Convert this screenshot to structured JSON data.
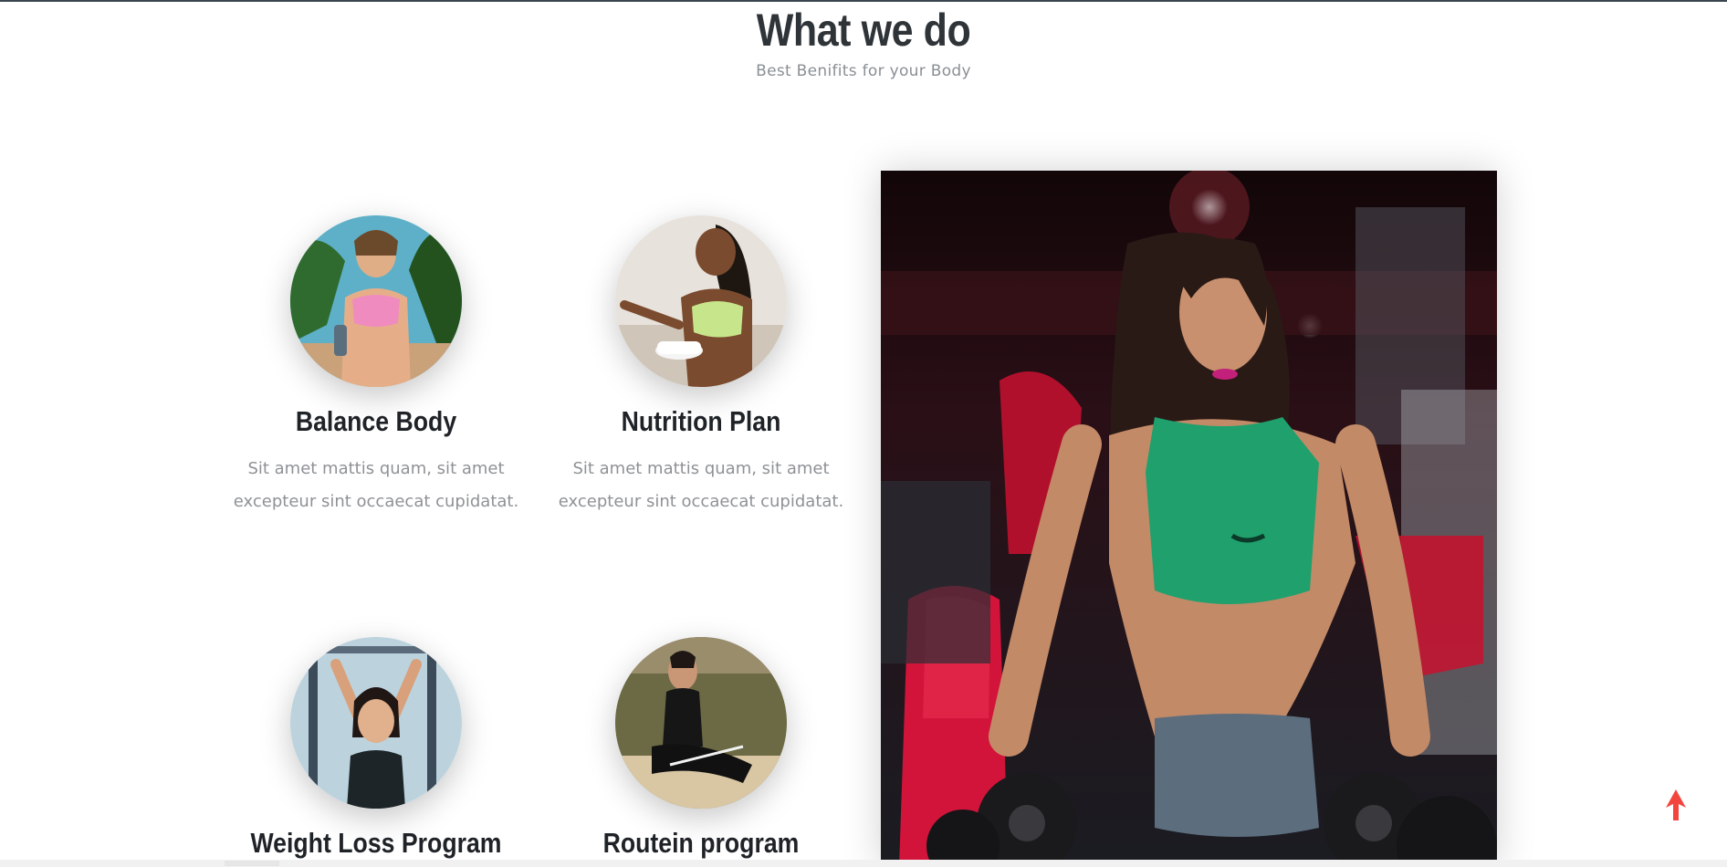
{
  "section": {
    "title": "What we do",
    "subtitle": "Best Benifits for your Body"
  },
  "services": [
    {
      "title": "Balance Body",
      "text": "Sit amet mattis quam, sit amet excepteur sint occaecat cupidatat."
    },
    {
      "title": "Nutrition Plan",
      "text": "Sit amet mattis quam, sit amet excepteur sint occaecat cupidatat."
    },
    {
      "title": "Weight Loss Program",
      "text": ""
    },
    {
      "title": "Routein program",
      "text": ""
    }
  ],
  "feature_image": {
    "alt": "fitness model photo",
    "colors": {
      "top": "#f06b4b",
      "accent": "#e21c3c",
      "top_wear": "#1f9a6a"
    }
  },
  "scroll_top": {
    "icon": "arrow-up-icon",
    "color": "#f2453d"
  }
}
